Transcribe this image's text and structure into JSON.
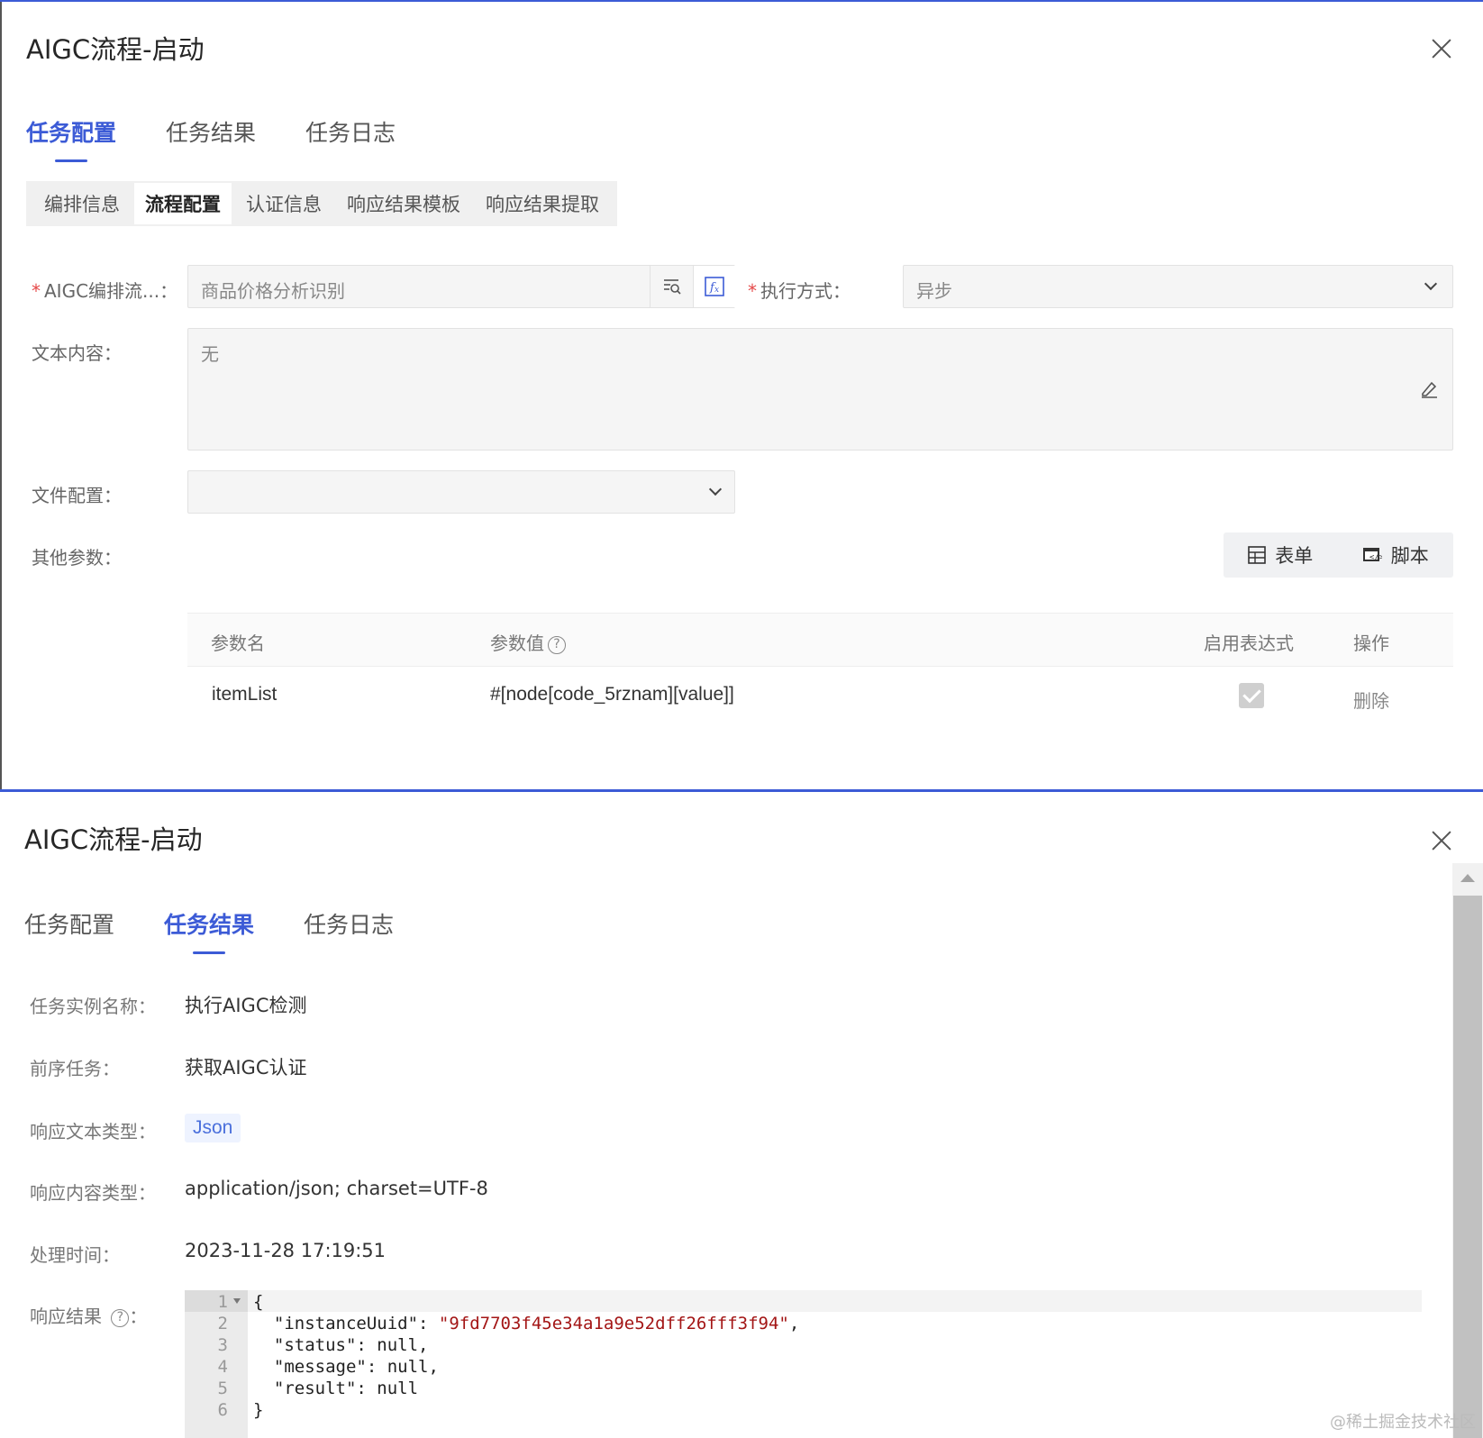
{
  "panel1": {
    "title": "AIGC流程-启动",
    "tabs": [
      "任务配置",
      "任务结果",
      "任务日志"
    ],
    "subtabs": [
      "编排信息",
      "流程配置",
      "认证信息",
      "响应结果模板",
      "响应结果提取"
    ],
    "fields": {
      "orchestration_label": "AIGC编排流...：",
      "orchestration_value": "商品价格分析识别",
      "exec_label": "执行方式：",
      "exec_value": "异步",
      "text_label": "文本内容：",
      "text_value": "无",
      "file_label": "文件配置：",
      "file_value": "",
      "other_label": "其他参数："
    },
    "buttons": {
      "form": "表单",
      "script": "脚本"
    },
    "table": {
      "headers": [
        "参数名",
        "参数值",
        "启用表达式",
        "操作"
      ],
      "rows": [
        {
          "name": "itemList",
          "value": "#[node[code_5rznam][value]]",
          "expr_enabled": true,
          "action": "删除"
        }
      ]
    }
  },
  "panel2": {
    "title": "AIGC流程-启动",
    "tabs": [
      "任务配置",
      "任务结果",
      "任务日志"
    ],
    "details": {
      "instance_label": "任务实例名称：",
      "instance_value": "执行AIGC检测",
      "prev_label": "前序任务：",
      "prev_value": "获取AIGC认证",
      "text_type_label": "响应文本类型：",
      "text_type_value": "Json",
      "content_type_label": "响应内容类型：",
      "content_type_value": "application/json; charset=UTF-8",
      "time_label": "处理时间：",
      "time_value": "2023-11-28 17:19:51",
      "result_label": "响应结果"
    },
    "code_lines": [
      "{",
      "  \"instanceUuid\": \"9fd7703f45e34a1a9e52dff26fff3f94\",",
      "  \"status\": null,",
      "  \"message\": null,",
      "  \"result\": null",
      "}"
    ]
  },
  "watermark": "@稀土掘金技术社区",
  "colors": {
    "accent": "#3c5bd6",
    "required": "#e54848",
    "string": "#a31515"
  },
  "icons": [
    "close-icon",
    "search-list-icon",
    "function-icon",
    "chevron-down-icon",
    "edit-icon",
    "table-icon",
    "script-icon",
    "help-icon",
    "checkbox-checked-icon",
    "fold-arrow-icon",
    "scroll-up-icon"
  ]
}
